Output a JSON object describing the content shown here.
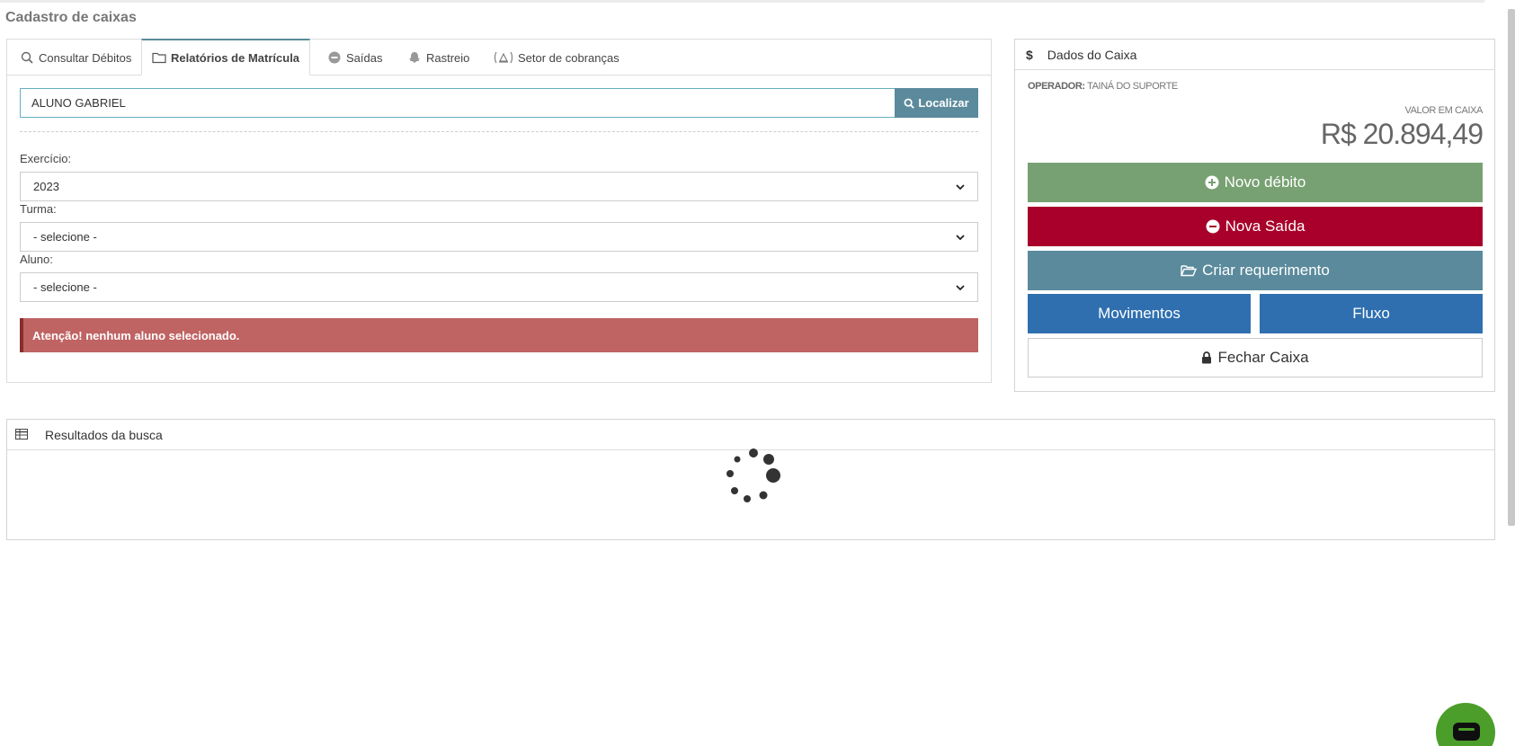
{
  "page": {
    "title": "Cadastro de caixas"
  },
  "tabs": [
    {
      "label": "Consultar Débitos",
      "icon": "search-icon"
    },
    {
      "label": "Relatórios de Matrícula",
      "icon": "folder-icon",
      "active": true
    },
    {
      "label": "Saídas",
      "icon": "minus-circle-icon"
    },
    {
      "label": "Rastreio",
      "icon": "snapchat-ghost-icon"
    },
    {
      "label": "Setor de cobranças",
      "icon": "scale-icon"
    }
  ],
  "search": {
    "value": "ALUNO GABRIEL",
    "button_label": "Localizar"
  },
  "form": {
    "exercicio_label": "Exercício:",
    "exercicio_value": "2023",
    "turma_label": "Turma:",
    "turma_value": "- selecione -",
    "aluno_label": "Aluno:",
    "aluno_value": "- selecione -"
  },
  "alert": {
    "text": "Atenção! nenhum aluno selecionado."
  },
  "caixa": {
    "header": "Dados do Caixa",
    "operator_label": "OPERADOR:",
    "operator_name": "TAINÁ DO SUPORTE",
    "valor_label": "VALOR EM CAIXA",
    "valor": "R$ 20.894,49",
    "buttons": {
      "novo_debito": "Novo débito",
      "nova_saida": "Nova Saída",
      "criar_requerimento": "Criar requerimento",
      "movimentos": "Movimentos",
      "fluxo": "Fluxo",
      "fechar_caixa": "Fechar Caixa"
    }
  },
  "results": {
    "header": "Resultados da busca"
  },
  "colors": {
    "green": "#77a172",
    "red": "#a8002a",
    "teal": "#5a8a9c",
    "blue": "#2f6fb0",
    "alert": "#c06363",
    "chat": "#4c9e2a"
  }
}
